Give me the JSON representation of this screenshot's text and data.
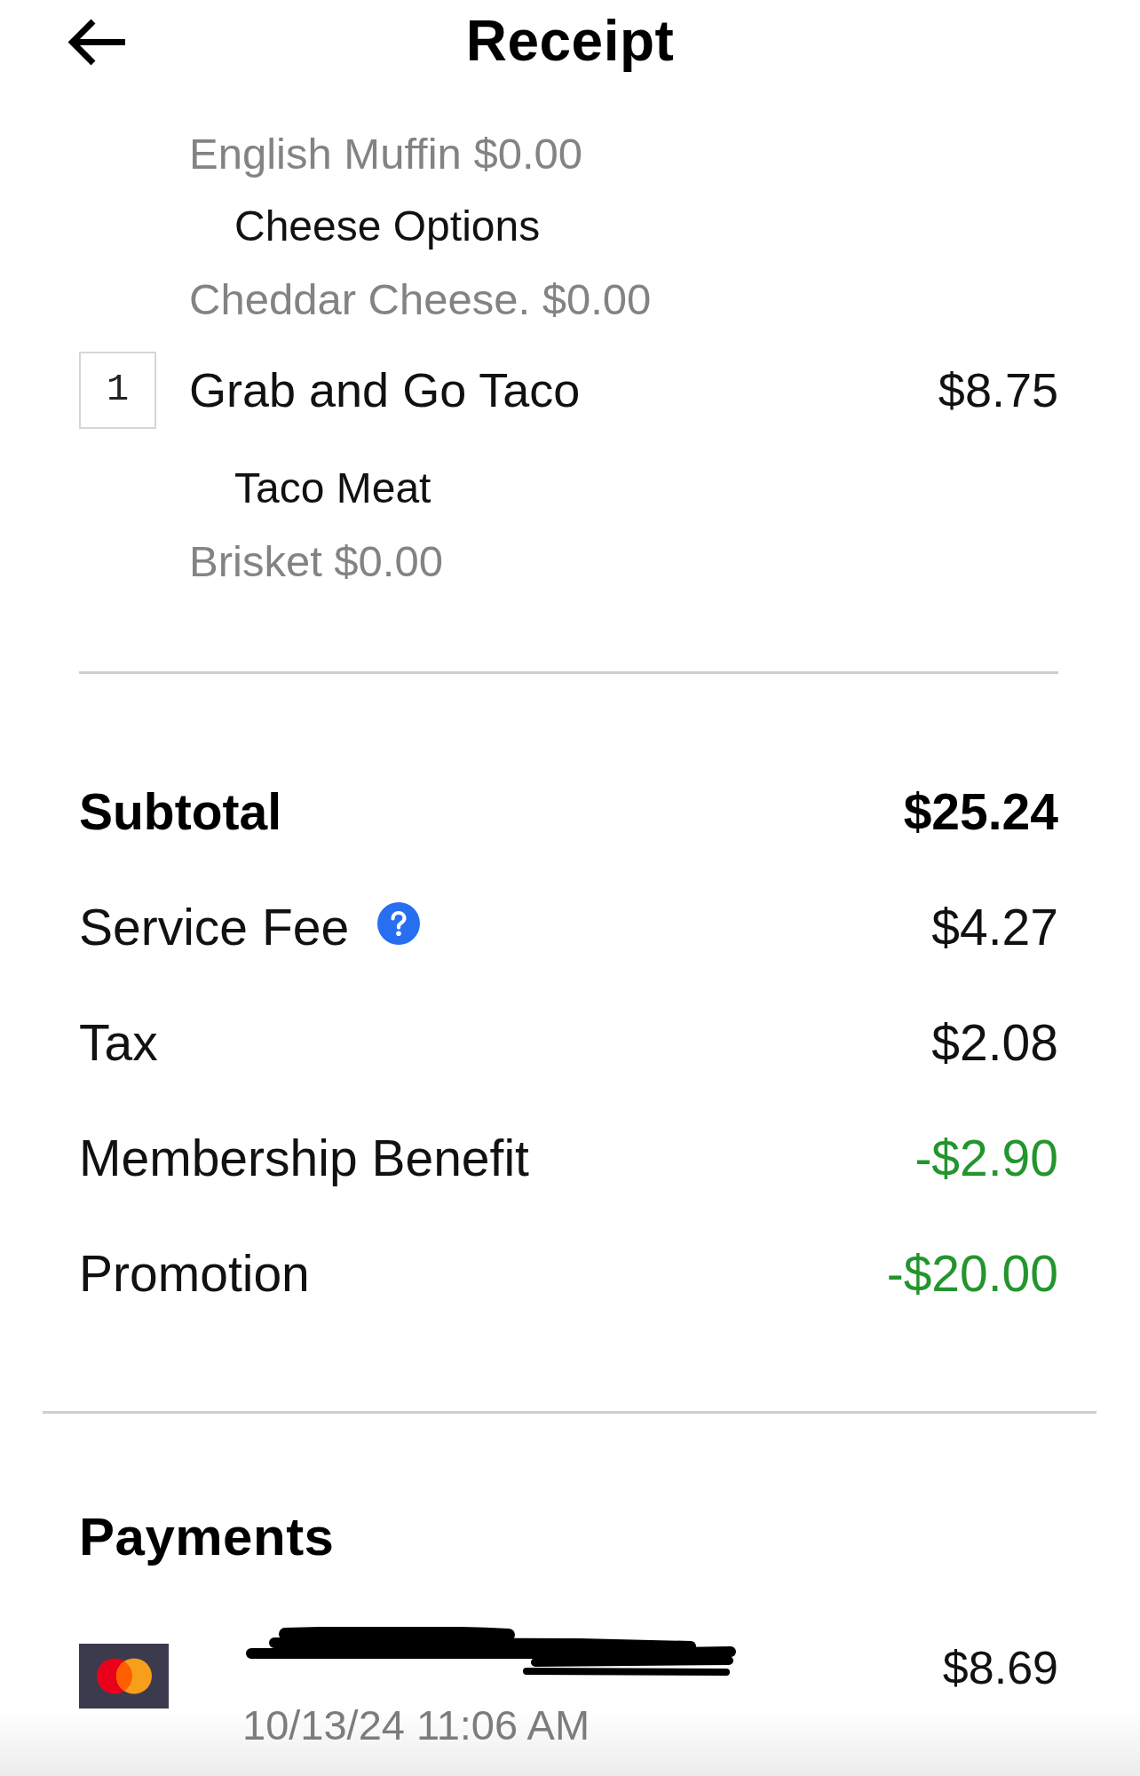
{
  "header": {
    "title": "Receipt"
  },
  "order": {
    "items": [
      {
        "groups": [
          {
            "options": [
              "English Muffin $0.00"
            ]
          },
          {
            "title": "Cheese Options",
            "options": [
              "Cheddar Cheese. $0.00"
            ]
          }
        ]
      },
      {
        "quantity": "1",
        "name": "Grab and Go Taco",
        "price": "$8.75",
        "groups": [
          {
            "title": "Taco Meat",
            "options": [
              "Brisket $0.00"
            ]
          }
        ]
      }
    ]
  },
  "charges": [
    {
      "kind": "subtotal",
      "label": "Subtotal",
      "info": false,
      "amount": "$25.24"
    },
    {
      "kind": "charge",
      "label": "Service Fee",
      "info": true,
      "amount": "$4.27"
    },
    {
      "kind": "charge",
      "label": "Tax",
      "info": false,
      "amount": "$2.08"
    },
    {
      "kind": "discount",
      "label": "Membership Benefit",
      "info": false,
      "amount": "-$2.90"
    },
    {
      "kind": "discount",
      "label": "Promotion",
      "info": false,
      "amount": "-$20.00"
    }
  ],
  "payments": {
    "title": "Payments",
    "entries": [
      {
        "redacted": true,
        "amount": "$8.69",
        "time": "10/13/24 11:06 AM"
      }
    ]
  }
}
